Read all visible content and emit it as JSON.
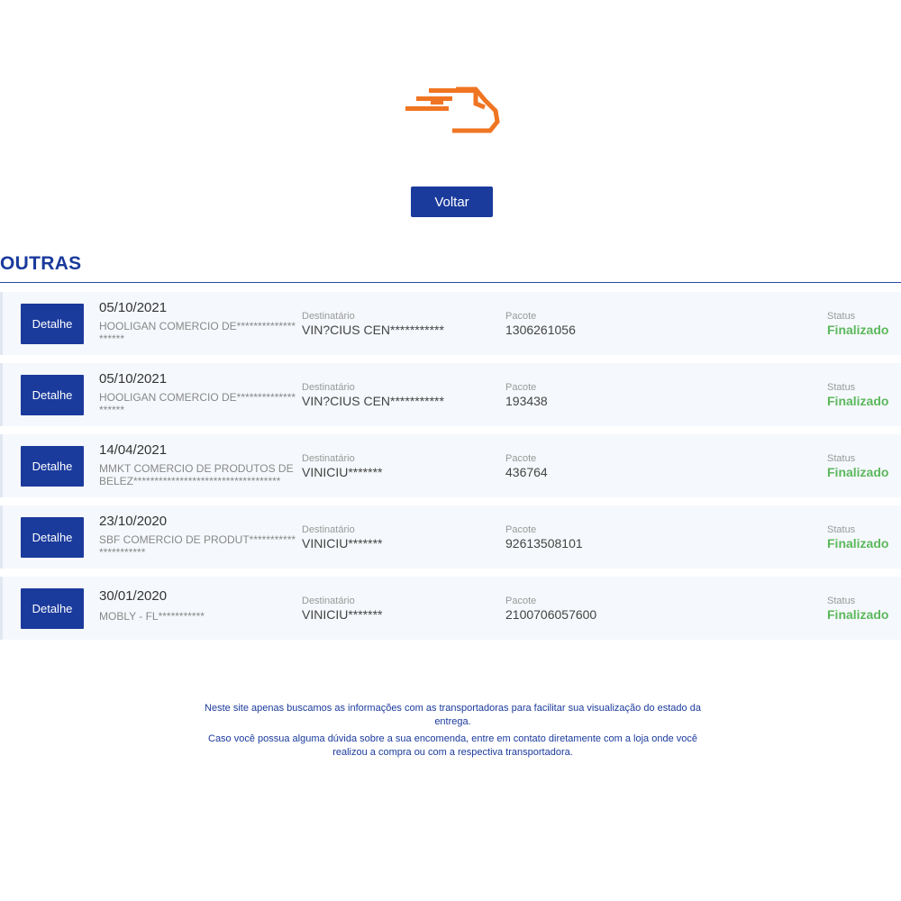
{
  "header": {
    "logo_icon": "truck-logo-icon",
    "back_label": "Voltar",
    "accent_color": "#f07522",
    "brand_color": "#1a3a9c"
  },
  "section": {
    "title": "OUTRAS"
  },
  "labels": {
    "detail_button": "Detalhe",
    "recipient": "Destinatário",
    "package": "Pacote",
    "status": "Status"
  },
  "shipments": [
    {
      "date": "05/10/2021",
      "sender": "HOOLIGAN COMERCIO DE********************",
      "recipient": "VIN?CIUS CEN***********",
      "package": "1306261056",
      "status": "Finalizado"
    },
    {
      "date": "05/10/2021",
      "sender": "HOOLIGAN COMERCIO DE********************",
      "recipient": "VIN?CIUS CEN***********",
      "package": "193438",
      "status": "Finalizado"
    },
    {
      "date": "14/04/2021",
      "sender": "MMKT COMERCIO DE PRODUTOS DE BELEZ***********************************",
      "recipient": "VINICIU*******",
      "package": "436764",
      "status": "Finalizado"
    },
    {
      "date": "23/10/2020",
      "sender": "SBF COMERCIO DE PRODUT**********************",
      "recipient": "VINICIU*******",
      "package": "92613508101",
      "status": "Finalizado"
    },
    {
      "date": "30/01/2020",
      "sender": "MOBLY - FL***********",
      "recipient": "VINICIU*******",
      "package": "2100706057600",
      "status": "Finalizado"
    }
  ],
  "footer": {
    "line1": "Neste site apenas buscamos as informações com as transportadoras para facilitar sua visualização do estado da entrega.",
    "line2": "Caso você possua alguma dúvida sobre a sua encomenda, entre em contato diretamente com a loja onde você realizou a compra ou com a respectiva transportadora."
  }
}
